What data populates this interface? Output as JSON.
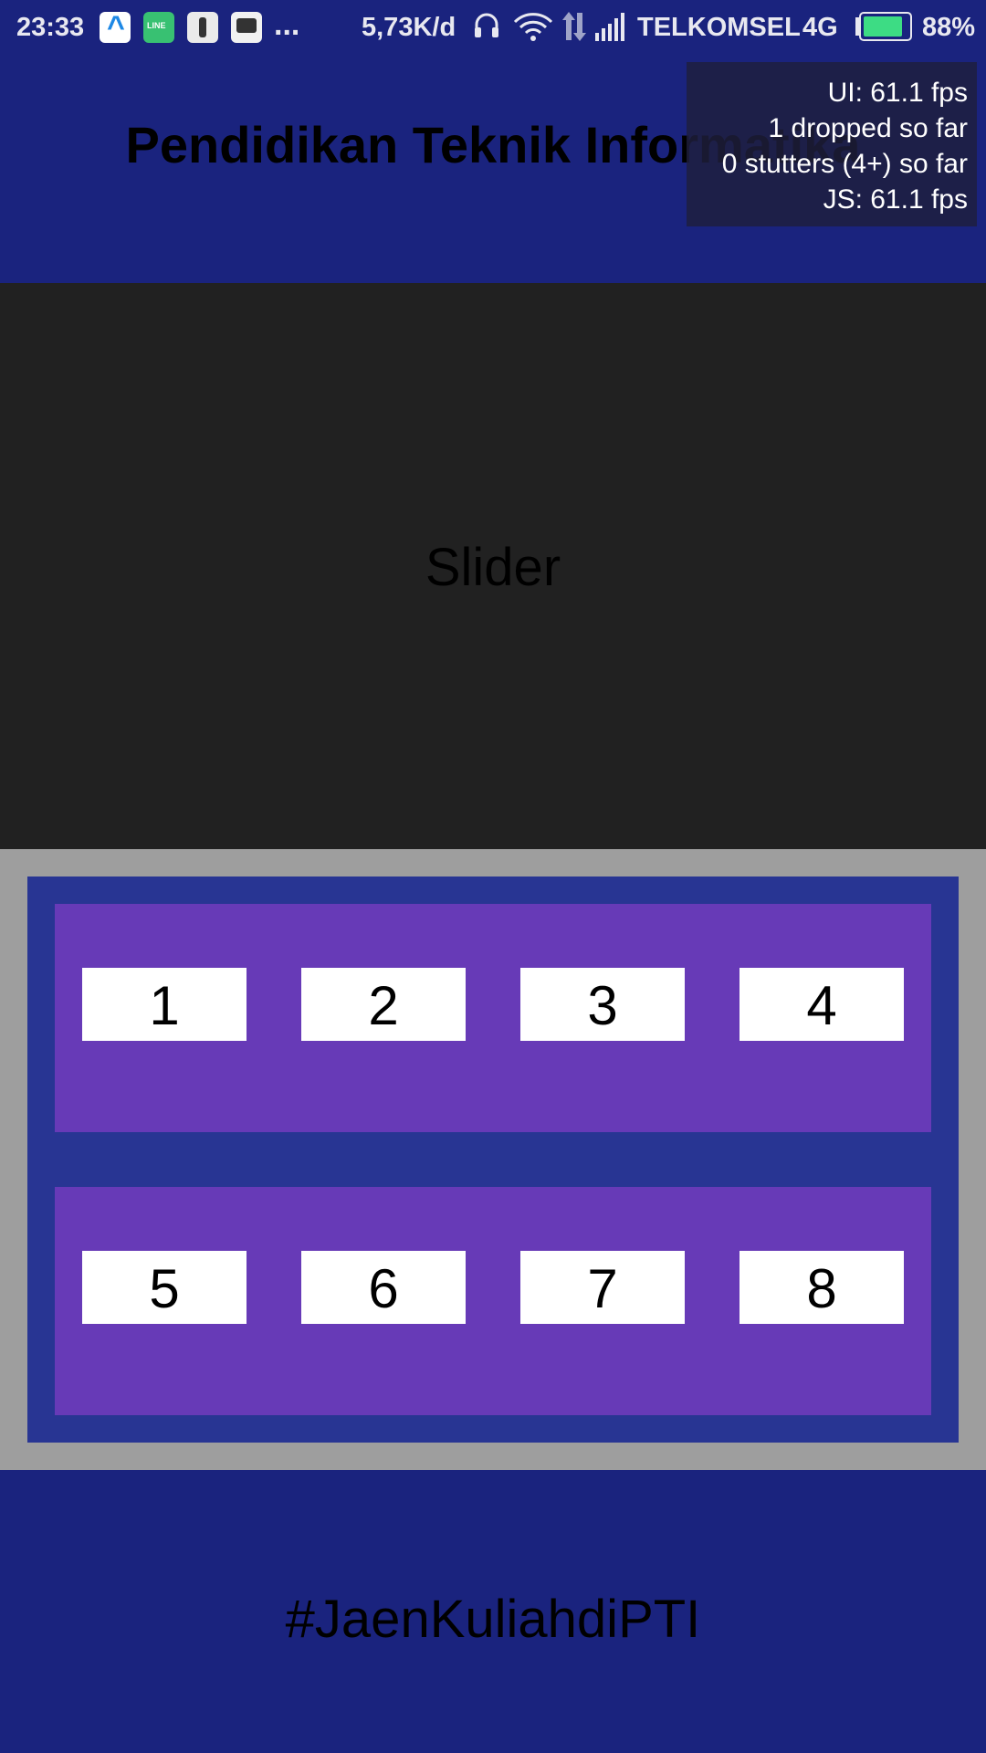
{
  "status_bar": {
    "time": "23:33",
    "app_icons": [
      "arrow-app-icon",
      "line-app-icon",
      "figure-app-icon",
      "bbm-app-icon"
    ],
    "more": "...",
    "net_speed": "5,73K/d",
    "carrier": "TELKOMSEL",
    "network": "4G",
    "battery_percent": "88%",
    "battery_level": 0.88,
    "battery_color": "#3ddc84"
  },
  "header": {
    "title": "Pendidikan Teknik Informatika"
  },
  "perf_monitor": {
    "ui_fps": "UI: 61.1 fps",
    "dropped": "1 dropped so far",
    "stutters": "0 stutters (4+) so far",
    "js_fps": "JS: 61.1 fps"
  },
  "slider": {
    "label": "Slider"
  },
  "grid": {
    "rows": [
      [
        "1",
        "2",
        "3",
        "4"
      ],
      [
        "5",
        "6",
        "7",
        "8"
      ]
    ]
  },
  "footer": {
    "hashtag": "#JaenKuliahdiPTI"
  },
  "colors": {
    "primary": "#1a237e",
    "slider_bg": "#212121",
    "grid_border": "#9e9e9e",
    "grid_inner": "#283593",
    "row_bg": "#673ab7",
    "cell_bg": "#ffffff"
  }
}
